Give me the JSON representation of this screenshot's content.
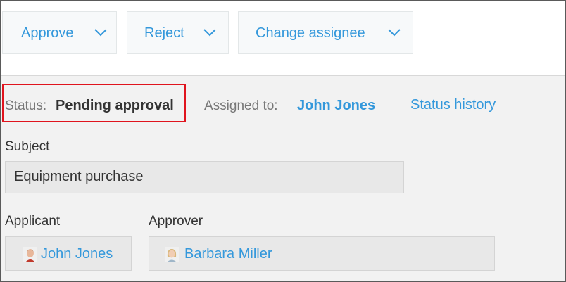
{
  "toolbar": {
    "approve_label": "Approve",
    "reject_label": "Reject",
    "change_assignee_label": "Change assignee"
  },
  "status": {
    "label": "Status:",
    "value": "Pending approval",
    "assigned_label": "Assigned to:",
    "assigned_value": "John Jones",
    "history_link": "Status history"
  },
  "subject": {
    "label": "Subject",
    "value": "Equipment purchase"
  },
  "applicant": {
    "label": "Applicant",
    "name": "John Jones"
  },
  "approver": {
    "label": "Approver",
    "name": "Barbara Miller"
  },
  "colors": {
    "link": "#3498db",
    "highlight_border": "#e0141e"
  },
  "icons": {
    "dropdown": "chevron-down-icon",
    "applicant_avatar": "male-avatar-icon",
    "approver_avatar": "female-avatar-icon"
  }
}
